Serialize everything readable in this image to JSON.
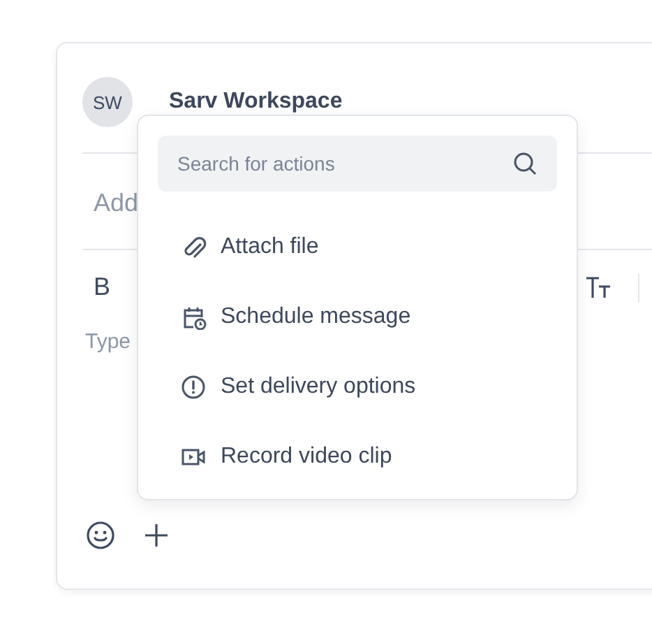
{
  "composer": {
    "avatar": "SW",
    "workspace": "Sarv Workspace",
    "subject_placeholder": "Add",
    "toolbar": {
      "bold": "B"
    },
    "body_placeholder": "Type"
  },
  "action_menu": {
    "search": {
      "placeholder": "Search for actions"
    },
    "items": [
      {
        "kind": "attach",
        "label": "Attach file"
      },
      {
        "kind": "schedule",
        "label": "Schedule message"
      },
      {
        "kind": "delivery",
        "label": "Set delivery options"
      },
      {
        "kind": "video",
        "label": "Record video clip"
      }
    ]
  }
}
